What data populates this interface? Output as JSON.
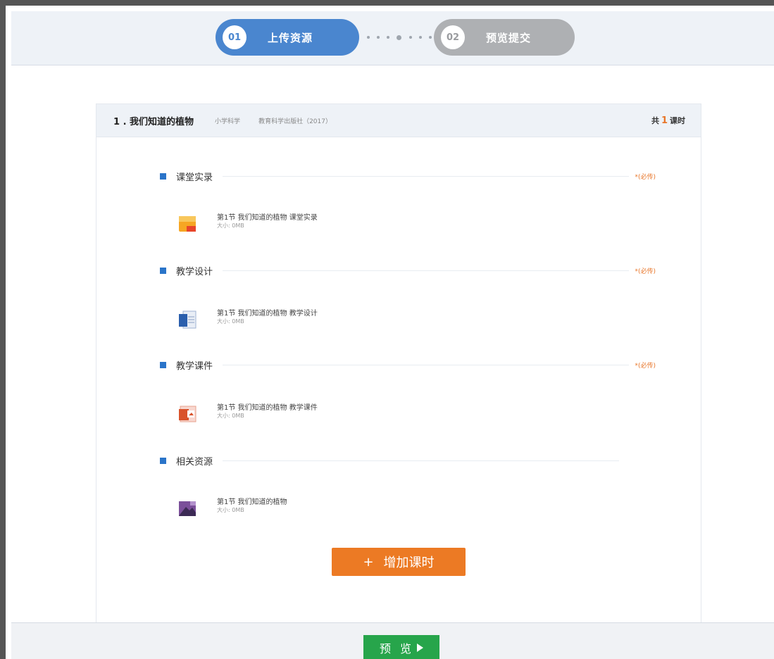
{
  "steps": [
    {
      "num": "01",
      "label": "上传资源",
      "active": true
    },
    {
      "num": "02",
      "label": "预览提交",
      "active": false
    }
  ],
  "lesson": {
    "title": "1 . 我们知道的植物",
    "subject": "小学科学",
    "publisher": "教育科学出版社（2017）",
    "count_prefix": "共",
    "count": "1",
    "count_suffix": "课时"
  },
  "sections": [
    {
      "title": "课堂实录",
      "required": "*(必传)",
      "resource": {
        "name": "第1节 我们知道的植物 课堂实录",
        "size": "大小: 0MB",
        "icon": "video-file-icon"
      }
    },
    {
      "title": "教学设计",
      "required": "*(必传)",
      "resource": {
        "name": "第1节 我们知道的植物 教学设计",
        "size": "大小: 0MB",
        "icon": "word-doc-icon"
      }
    },
    {
      "title": "教学课件",
      "required": "*(必传)",
      "resource": {
        "name": "第1节 我们知道的植物 教学课件",
        "size": "大小: 0MB",
        "icon": "ppt-file-icon"
      }
    },
    {
      "title": "相关资源",
      "required": "",
      "resource": {
        "name": "第1节 我们知道的植物",
        "size": "大小: 0MB",
        "icon": "resource-file-icon"
      }
    }
  ],
  "add_button": {
    "plus": "+",
    "label": "增加课时"
  },
  "preview_button": {
    "label": "预 览"
  },
  "colors": {
    "accent_blue": "#4a86cf",
    "accent_orange": "#ec7a24",
    "accent_green": "#27a54b"
  }
}
